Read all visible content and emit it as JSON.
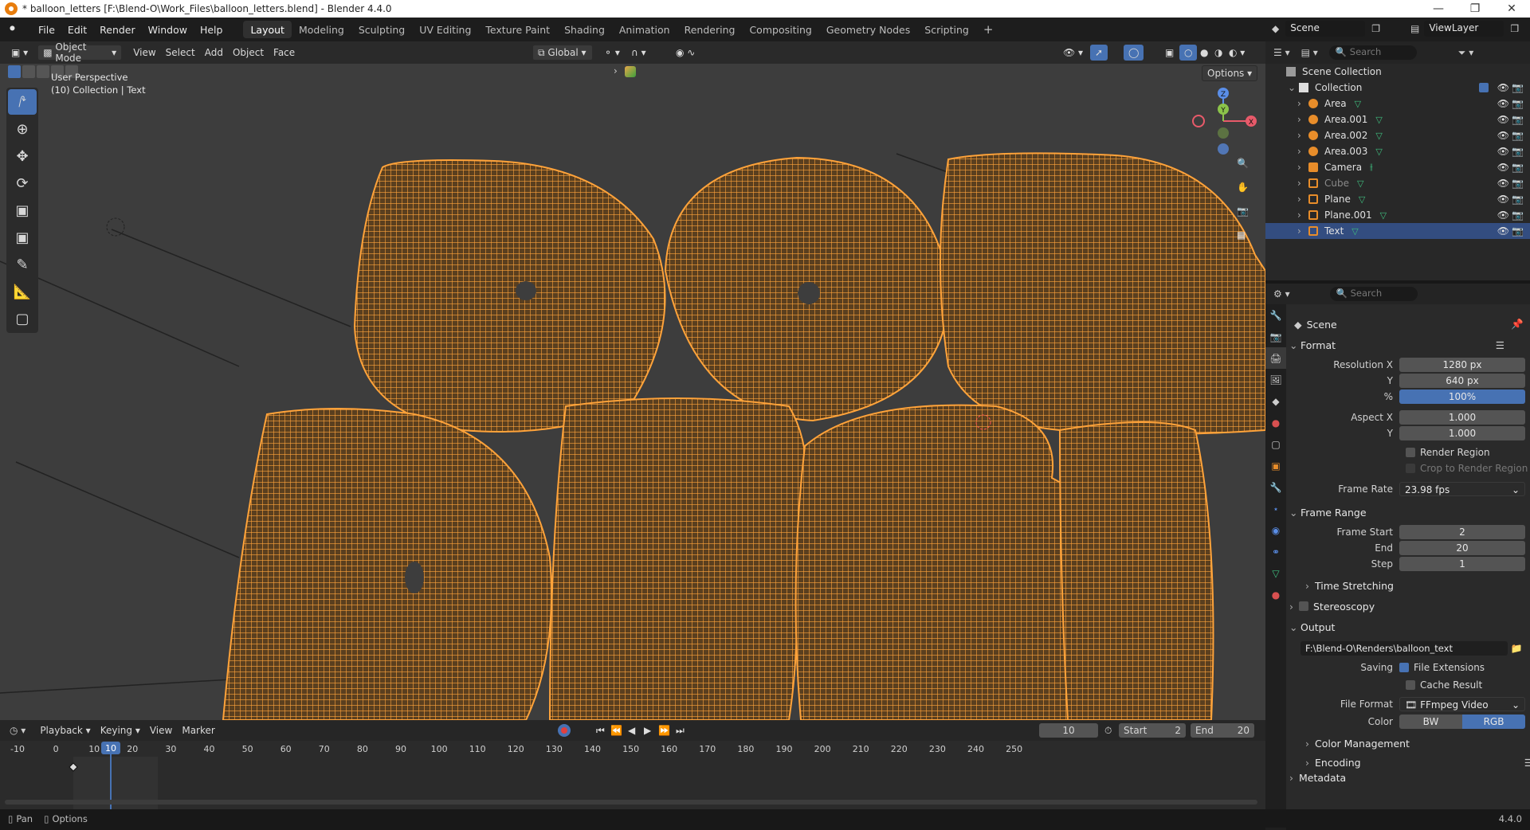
{
  "window": {
    "title": "* balloon_letters [F:\\Blend-O\\Work_Files\\balloon_letters.blend] - Blender 4.4.0"
  },
  "menu": [
    "File",
    "Edit",
    "Render",
    "Window",
    "Help"
  ],
  "workspaces": [
    "Layout",
    "Modeling",
    "Sculpting",
    "UV Editing",
    "Texture Paint",
    "Shading",
    "Animation",
    "Rendering",
    "Compositing",
    "Geometry Nodes",
    "Scripting"
  ],
  "active_workspace": "Layout",
  "scene_selector": {
    "scene": "Scene",
    "view_layer": "ViewLayer"
  },
  "viewport": {
    "mode": "Object Mode",
    "menus": [
      "View",
      "Select",
      "Add",
      "Object",
      "Face"
    ],
    "orientation": "Global",
    "options_label": "Options",
    "overlay_line1": "User Perspective",
    "overlay_line2": "(10) Collection | Text",
    "gizmo_axes": [
      "Z",
      "Y",
      "X"
    ],
    "wire_color": "#ff9f2e"
  },
  "outliner": {
    "search_placeholder": "Search",
    "root": "Scene Collection",
    "collection": "Collection",
    "items": [
      {
        "name": "Area",
        "type": "light"
      },
      {
        "name": "Area.001",
        "type": "light"
      },
      {
        "name": "Area.002",
        "type": "light"
      },
      {
        "name": "Area.003",
        "type": "light"
      },
      {
        "name": "Camera",
        "type": "camera"
      },
      {
        "name": "Cube",
        "type": "mesh"
      },
      {
        "name": "Plane",
        "type": "mesh"
      },
      {
        "name": "Plane.001",
        "type": "mesh"
      },
      {
        "name": "Text",
        "type": "mesh"
      }
    ],
    "selected": "Text"
  },
  "properties": {
    "search_placeholder": "Search",
    "context": "Scene",
    "format_title": "Format",
    "res_x_label": "Resolution X",
    "res_x": "1280 px",
    "res_y_label": "Y",
    "res_y": "640 px",
    "res_pct_label": "%",
    "res_pct": "100%",
    "aspect_x_label": "Aspect X",
    "aspect_x": "1.000",
    "aspect_y_label": "Y",
    "aspect_y": "1.000",
    "render_region": "Render Region",
    "crop_region": "Crop to Render Region",
    "frame_rate_label": "Frame Rate",
    "frame_rate": "23.98 fps",
    "frame_range_title": "Frame Range",
    "frame_start_label": "Frame Start",
    "frame_start": "2",
    "end_label": "End",
    "end": "20",
    "step_label": "Step",
    "step": "1",
    "time_stretching": "Time Stretching",
    "stereoscopy": "Stereoscopy",
    "output_title": "Output",
    "output_path": "F:\\Blend-O\\Renders\\balloon_text",
    "saving_label": "Saving",
    "file_extensions": "File Extensions",
    "cache_result": "Cache Result",
    "file_format_label": "File Format",
    "file_format": "FFmpeg Video",
    "color_label": "Color",
    "color_bw": "BW",
    "color_rgb": "RGB",
    "color_management": "Color Management",
    "encoding": "Encoding",
    "metadata": "Metadata"
  },
  "timeline": {
    "menus": [
      "Playback",
      "Keying",
      "View",
      "Marker"
    ],
    "current_frame": "10",
    "start_label": "Start",
    "start": "2",
    "end_label": "End",
    "end": "20",
    "ticks": [
      "-10",
      "0",
      "10",
      "20",
      "30",
      "40",
      "50",
      "60",
      "70",
      "80",
      "90",
      "100",
      "110",
      "120",
      "130",
      "140",
      "150",
      "160",
      "170",
      "180",
      "190",
      "200",
      "210",
      "220",
      "230",
      "240",
      "250"
    ]
  },
  "status": {
    "pan": "Pan",
    "options": "Options",
    "version": "4.4.0"
  }
}
